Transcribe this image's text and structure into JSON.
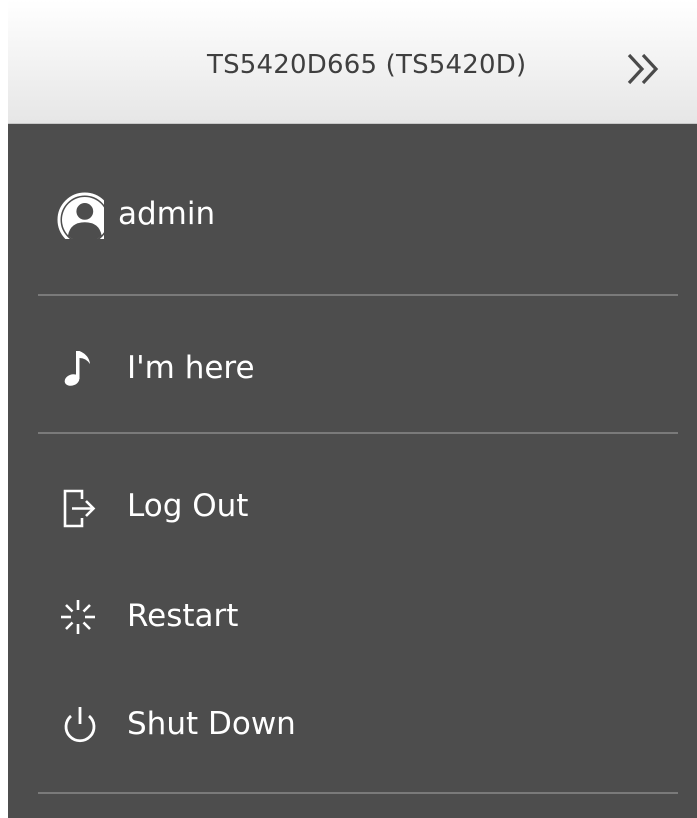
{
  "header": {
    "title": "TS5420D665 (TS5420D)",
    "collapse_icon": "double-chevron-right-icon"
  },
  "menu": {
    "user": {
      "label": "admin",
      "icon": "user-avatar-icon"
    },
    "locate": {
      "label": "I'm here",
      "icon": "music-note-icon"
    },
    "logout": {
      "label": "Log Out",
      "icon": "logout-icon"
    },
    "restart": {
      "label": "Restart",
      "icon": "restart-icon"
    },
    "shutdown": {
      "label": "Shut Down",
      "icon": "power-icon"
    }
  },
  "colors": {
    "header_bg": "#f0f0f0",
    "menu_bg": "#4d4d4d",
    "divider": "#7a7a7a",
    "text": "#ffffff",
    "header_text": "#3f3f3f"
  }
}
